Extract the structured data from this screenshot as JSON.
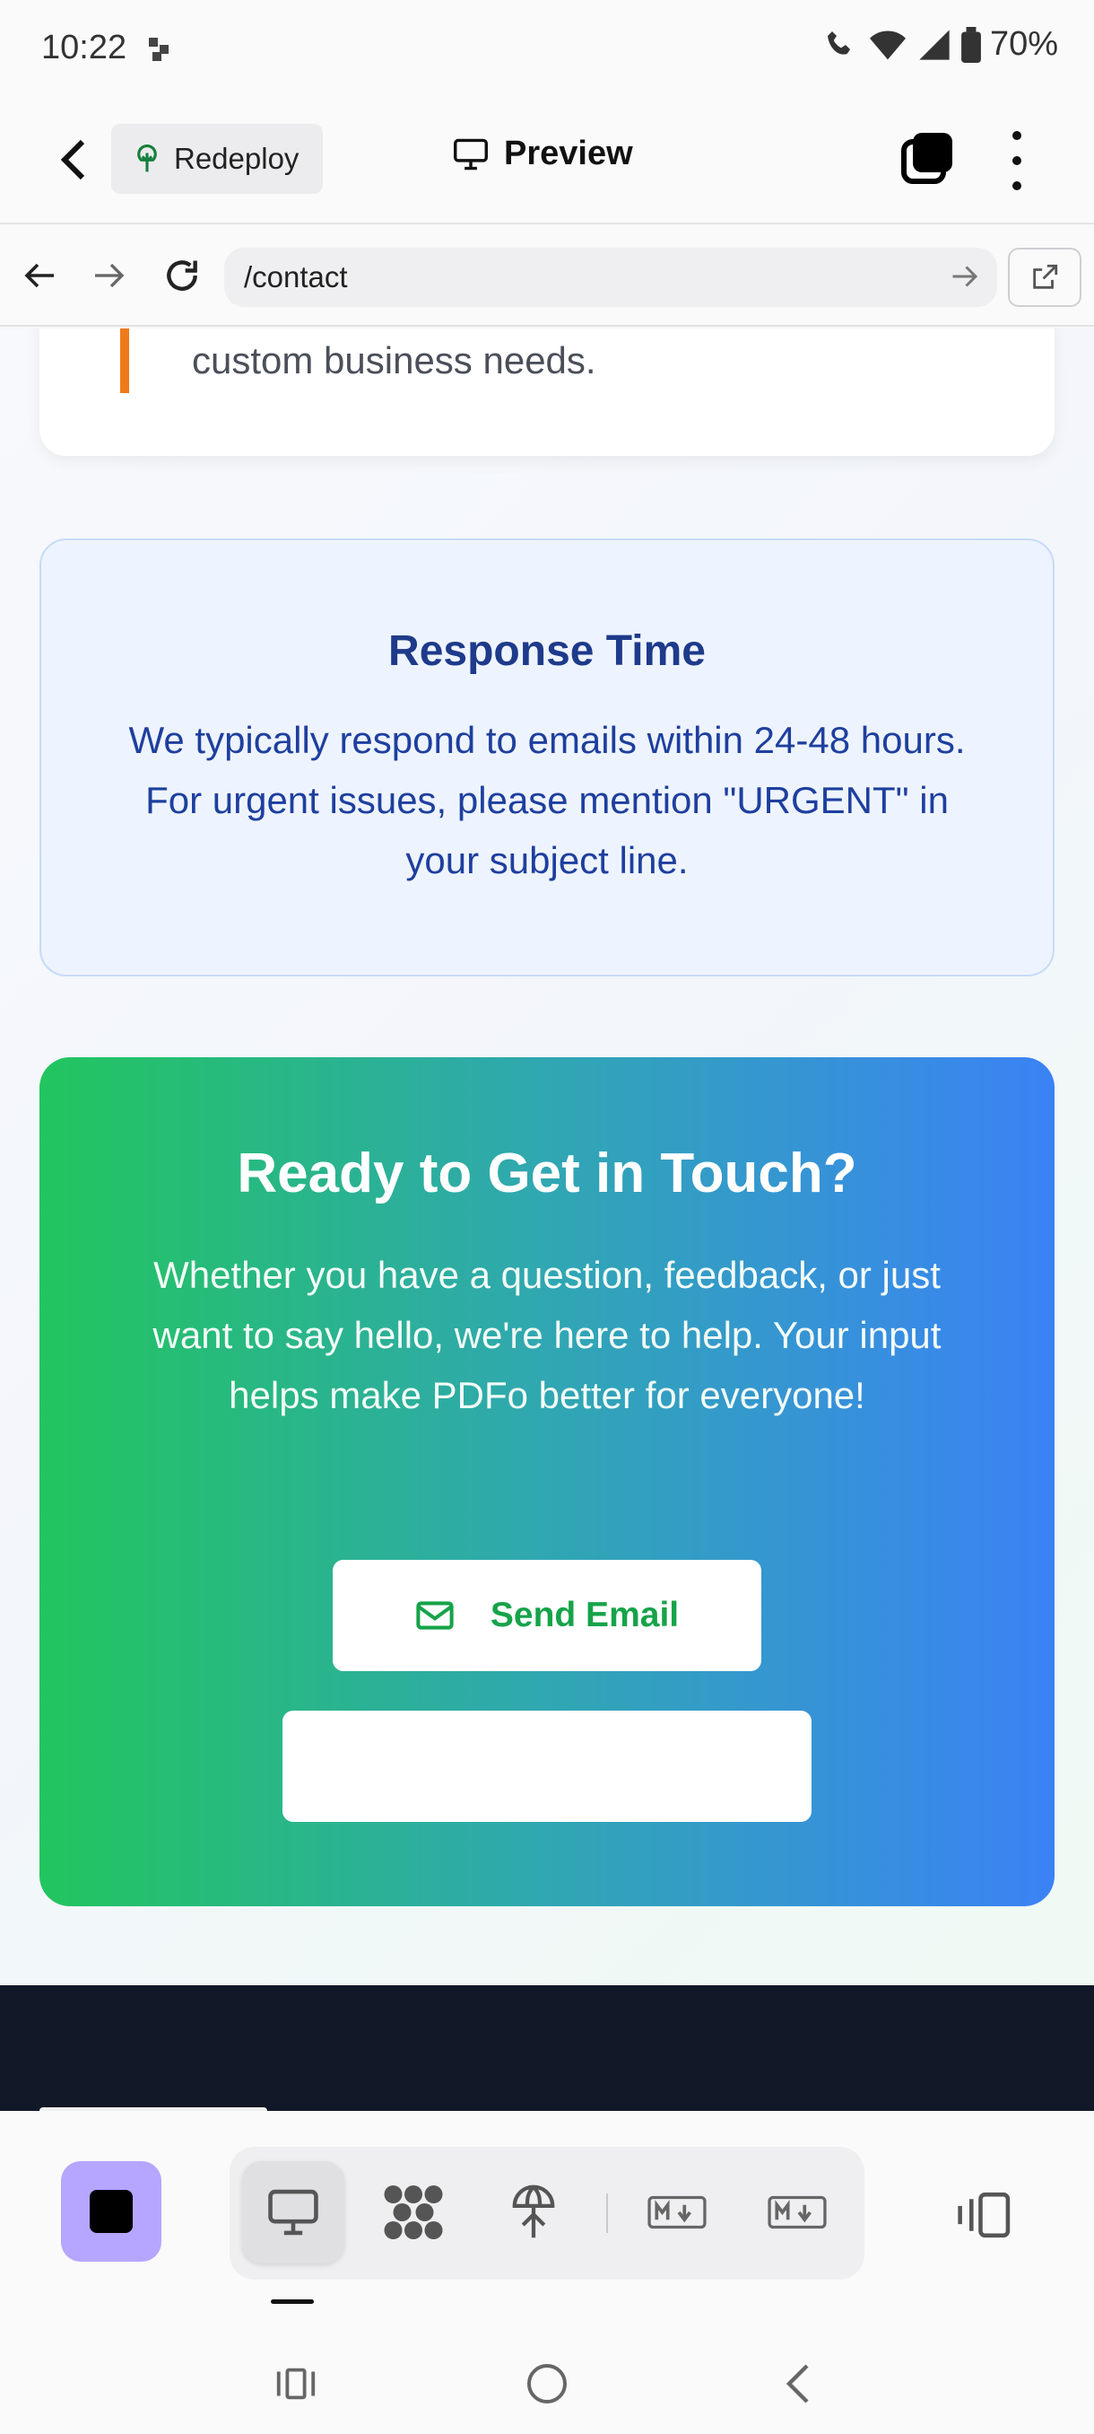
{
  "status": {
    "time": "10:22",
    "battery": "70%"
  },
  "appbar": {
    "redeploy_label": "Redeploy",
    "preview_label": "Preview"
  },
  "urlbar": {
    "url": "/contact"
  },
  "content": {
    "top_card_text": "custom business needs.",
    "response": {
      "title": "Response Time",
      "body": "We typically respond to emails within 24-48 hours. For urgent issues, please mention \"URGENT\" in your subject line."
    },
    "cta": {
      "title": "Ready to Get in Touch?",
      "body": "Whether you have a question, feedback, or just want to say hello, we're here to help. Your input helps make PDFo better for everyone!",
      "send_label": "Send Email"
    }
  },
  "colors": {
    "accent_orange": "#f07a1a",
    "cta_green": "#22c55e",
    "cta_blue": "#3b82f6",
    "stop_purple": "#b6a6ff",
    "footer_dark": "#111827"
  },
  "icons": [
    "back-icon",
    "redeploy-tree-icon",
    "monitor-icon",
    "layers-icon",
    "more-icon",
    "nav-back-icon",
    "nav-forward-icon",
    "refresh-icon",
    "go-arrow-icon",
    "external-link-icon",
    "mail-icon",
    "stop-icon",
    "desktop-icon",
    "nodes-icon",
    "deploy-icon",
    "markdown-icon",
    "device-toggle-icon"
  ]
}
